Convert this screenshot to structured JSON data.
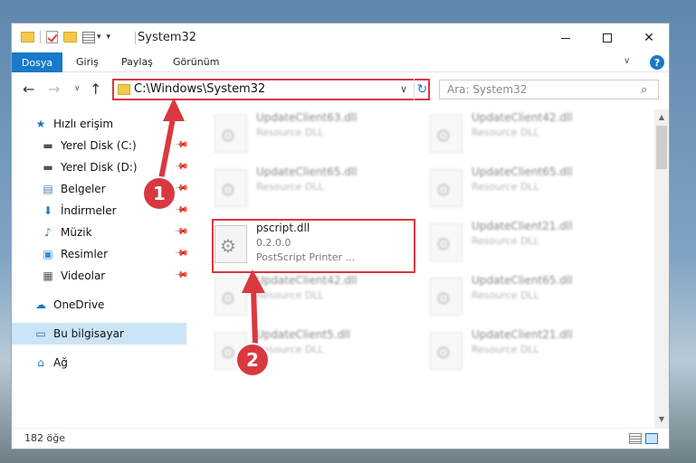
{
  "window": {
    "title": "System32",
    "controls": {
      "minimize": "—",
      "maximize": "☐",
      "close": "✕"
    }
  },
  "ribbon": {
    "tabs": [
      "Dosya",
      "Giriş",
      "Paylaş",
      "Görünüm"
    ],
    "expand": "∨",
    "help": "?"
  },
  "navbar": {
    "back": "←",
    "forward": "→",
    "recent": "∨",
    "up": "↑",
    "address": "C:\\Windows\\System32",
    "address_dropdown": "∨",
    "refresh": "↻",
    "search_placeholder": "Ara: System32",
    "search_icon": "⌕"
  },
  "sidebar": {
    "items": [
      {
        "label": "Hızlı erişim",
        "icon": "★",
        "pinned": false
      },
      {
        "label": "Yerel Disk (C:)",
        "icon": "▬",
        "pinned": true
      },
      {
        "label": "Yerel Disk (D:)",
        "icon": "▬",
        "pinned": true
      },
      {
        "label": "Belgeler",
        "icon": "▤",
        "pinned": true
      },
      {
        "label": "İndirmeler",
        "icon": "⬇",
        "pinned": true
      },
      {
        "label": "Müzik",
        "icon": "♪",
        "pinned": true
      },
      {
        "label": "Resimler",
        "icon": "▣",
        "pinned": true
      },
      {
        "label": "Videolar",
        "icon": "▦",
        "pinned": true
      },
      {
        "label": "OneDrive",
        "icon": "☁",
        "pinned": false
      },
      {
        "label": "Bu bilgisayar",
        "icon": "▭",
        "pinned": false,
        "selected": true
      },
      {
        "label": "Ağ",
        "icon": "⌂",
        "pinned": false
      }
    ],
    "pin_glyph": "📌"
  },
  "files": [
    {
      "name": "UpdateClient63.dll",
      "sub": "Resource DLL",
      "blurred": true
    },
    {
      "name": "UpdateClient42.dll",
      "sub": "Resource DLL",
      "blurred": true
    },
    {
      "name": "UpdateClient65.dll",
      "sub": "Resource DLL",
      "blurred": true
    },
    {
      "name": "UpdateClient65.dll",
      "sub": "Resource DLL",
      "blurred": true
    },
    {
      "name": "pscript.dll",
      "sub": "0.2.0.0",
      "desc": "PostScript Printer ...",
      "blurred": false
    },
    {
      "name": "UpdateClient21.dll",
      "sub": "Resource DLL",
      "blurred": true
    },
    {
      "name": "UpdateClient42.dll",
      "sub": "Resource DLL",
      "blurred": true
    },
    {
      "name": "UpdateClient65.dll",
      "sub": "Resource DLL",
      "blurred": true
    },
    {
      "name": "UpdateClient5.dll",
      "sub": "Resource DLL",
      "blurred": true
    },
    {
      "name": "UpdateClient21.dll",
      "sub": "Resource DLL",
      "blurred": true
    }
  ],
  "status": {
    "count": "182 öğe"
  },
  "callouts": [
    "1",
    "2"
  ],
  "colors": {
    "accent": "#1979ca",
    "highlight": "#d9383f",
    "selected": "#cce4f7"
  }
}
